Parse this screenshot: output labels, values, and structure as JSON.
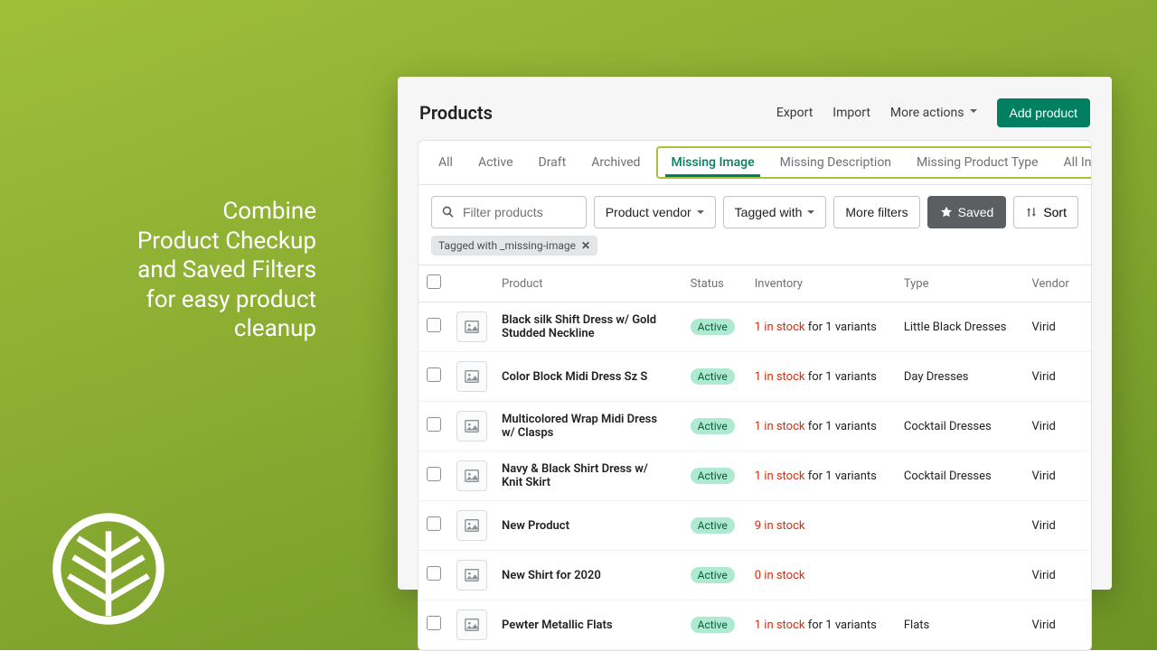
{
  "promo": {
    "line1a": "Combine",
    "line2a": "Product Checkup",
    "line2b": "and Saved Filters",
    "line3a": "for easy product",
    "line3b": "cleanup"
  },
  "page": {
    "title": "Products"
  },
  "header_actions": {
    "export": "Export",
    "import": "Import",
    "more": "More actions",
    "add": "Add product"
  },
  "tabs": {
    "all": "All",
    "active": "Active",
    "draft": "Draft",
    "archived": "Archived",
    "missing_image": "Missing Image",
    "missing_desc": "Missing Description",
    "missing_type": "Missing Product Type",
    "all_incomplete": "All Incomplete Products"
  },
  "filters": {
    "search_placeholder": "Filter products",
    "vendor": "Product vendor",
    "tagged": "Tagged with",
    "more": "More filters",
    "saved": "Saved",
    "sort": "Sort"
  },
  "active_tag": "Tagged with _missing-image",
  "columns": {
    "product": "Product",
    "status": "Status",
    "inventory": "Inventory",
    "type": "Type",
    "vendor": "Vendor"
  },
  "rows": [
    {
      "name": "Black silk Shift Dress w/ Gold Studded Neckline",
      "status": "Active",
      "inv_red": "1 in stock",
      "inv_rest": " for 1 variants",
      "type": "Little Black Dresses",
      "vendor": "Virid"
    },
    {
      "name": "Color Block Midi Dress Sz S",
      "status": "Active",
      "inv_red": "1 in stock",
      "inv_rest": " for 1 variants",
      "type": "Day Dresses",
      "vendor": "Virid"
    },
    {
      "name": "Multicolored Wrap Midi Dress w/ Clasps",
      "status": "Active",
      "inv_red": "1 in stock",
      "inv_rest": " for 1 variants",
      "type": "Cocktail Dresses",
      "vendor": "Virid"
    },
    {
      "name": "Navy & Black Shirt Dress w/ Knit Skirt",
      "status": "Active",
      "inv_red": "1 in stock",
      "inv_rest": " for 1 variants",
      "type": "Cocktail Dresses",
      "vendor": "Virid"
    },
    {
      "name": "New Product",
      "status": "Active",
      "inv_red": "9 in stock",
      "inv_rest": "",
      "type": "",
      "vendor": "Virid"
    },
    {
      "name": "New Shirt for 2020",
      "status": "Active",
      "inv_red": "0 in stock",
      "inv_rest": "",
      "type": "",
      "vendor": "Virid"
    },
    {
      "name": "Pewter Metallic Flats",
      "status": "Active",
      "inv_red": "1 in stock",
      "inv_rest": " for 1 variants",
      "type": "Flats",
      "vendor": "Virid"
    }
  ]
}
